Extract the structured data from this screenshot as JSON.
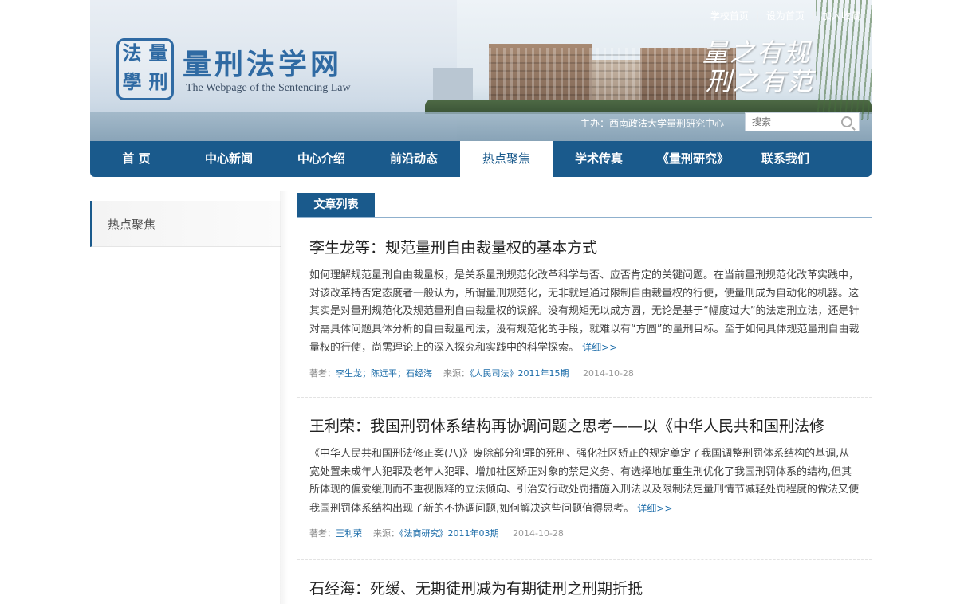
{
  "header": {
    "logo_chars": [
      "法",
      "量",
      "學",
      "刑"
    ],
    "site_title": "量刑法学网",
    "site_subtitle": "The Webpage of the Sentencing Law",
    "top_links": [
      "学校首页",
      "设为首页",
      "加入收藏"
    ],
    "motto_line1": "量之有规",
    "motto_line2": "刑之有范",
    "sponsor": "主办：西南政法大学量刑研究中心",
    "search_placeholder": "搜索"
  },
  "nav": {
    "items": [
      "首 页",
      "中心新闻",
      "中心介绍",
      "前沿动态",
      "热点聚焦",
      "学术传真",
      "《量刑研究》",
      "联系我们"
    ],
    "active_index": 4
  },
  "sidebar": {
    "current": "热点聚焦"
  },
  "main": {
    "tab_label": "文章列表",
    "articles": [
      {
        "title": "李生龙等：规范量刑自由裁量权的基本方式",
        "summary": "如何理解规范量刑自由裁量权，是关系量刑规范化改革科学与否、应否肯定的关键问题。在当前量刑规范化改革实践中，对该改革持否定态度者一般认为，所谓量刑规范化，无非就是通过限制自由裁量权的行使，使量刑成为自动化的机器。这其实是对量刑规范化及规范量刑自由裁量权的误解。没有规矩无以成方圆，无论是基于“幅度过大”的法定刑立法，还是针对需具体问题具体分析的自由裁量司法，没有规范化的手段，就难以有“方圆”的量刑目标。至于如何具体规范量刑自由裁量权的行使，尚需理论上的深入探究和实践中的科学探索。",
        "more": "详细>>",
        "author_label": "著者：",
        "authors": "李生龙；陈远平；石经海",
        "source_label": "来源：",
        "source": "《人民司法》2011年15期",
        "date": "2014-10-28"
      },
      {
        "title": "王利荣：我国刑罚体系结构再协调问题之思考——以《中华人民共和国刑法修",
        "summary": "《中华人民共和国刑法修正案(八)》废除部分犯罪的死刑、强化社区矫正的规定奠定了我国调整刑罚体系结构的基调,从宽处置未成年人犯罪及老年人犯罪、增加社区矫正对象的禁足义务、有选择地加重生刑优化了我国刑罚体系的结构,但其所体现的偏爱缓刑而不重视假释的立法倾向、引治安行政处罚措施入刑法以及限制法定量刑情节减轻处罚程度的做法又使我国刑罚体系结构出现了新的不协调问题,如何解决这些问题值得思考。",
        "more": "详细>>",
        "author_label": "著者：",
        "authors": "王利荣",
        "source_label": "来源：",
        "source": "《法商研究》2011年03期",
        "date": "2014-10-28"
      },
      {
        "title": "石经海：死缓、无期徒刑减为有期徒刑之刑期折抵"
      }
    ]
  }
}
